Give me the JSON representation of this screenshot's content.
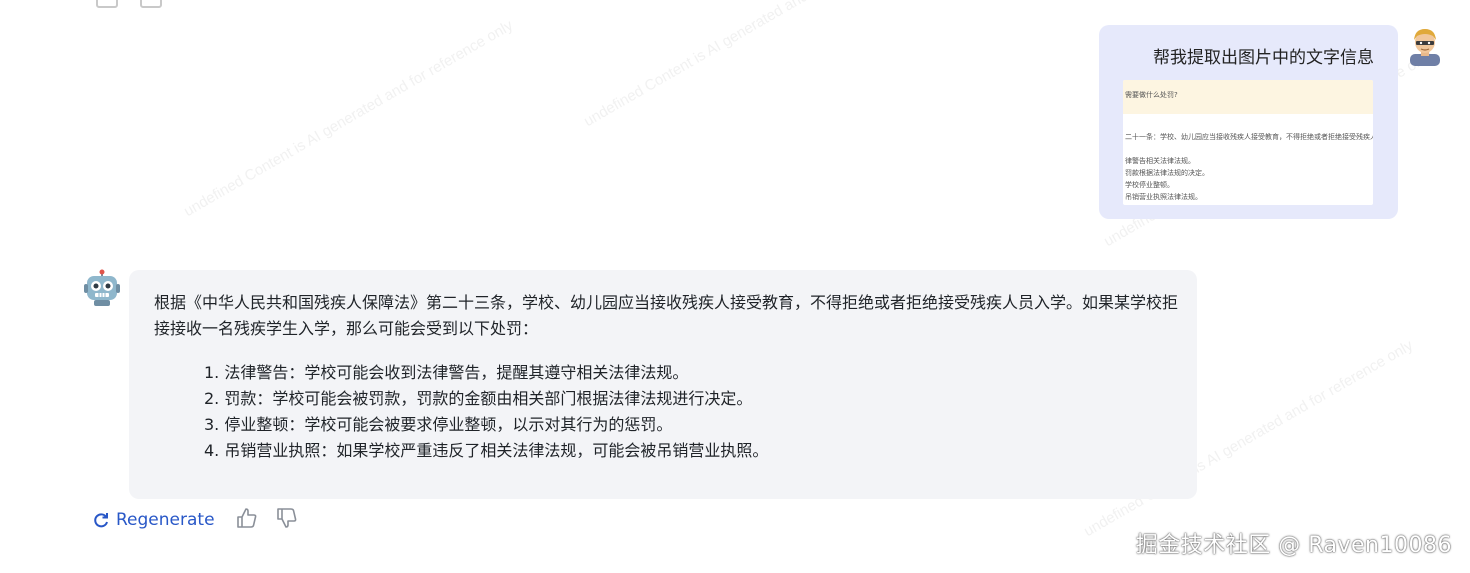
{
  "user_message": {
    "text": "帮我提取出图片中的文字信息",
    "thumbnail_lines": [
      "需要做什么处罚?",
      "二十一条：学校、幼儿园应当接收残疾人接受教育，不得拒绝或者拒绝接受残疾人",
      "律警告相关法律法规。",
      "罚款根据法律法规的决定。",
      "学校停业整顿。",
      "吊销营业执照法律法规。"
    ]
  },
  "bot_message": {
    "intro": "根据《中华人民共和国残疾人保障法》第二十三条，学校、幼儿园应当接收残疾人接受教育，不得拒绝或者拒绝接受残疾人员入学。如果某学校拒接接收一名残疾学生入学，那么可能会受到以下处罚：",
    "items": [
      "1. 法律警告：学校可能会收到法律警告，提醒其遵守相关法律法规。",
      "2. 罚款：学校可能会被罚款，罚款的金额由相关部门根据法律法规进行决定。",
      "3. 停业整顿：学校可能会被要求停业整顿，以示对其行为的惩罚。",
      "4. 吊销营业执照：如果学校严重违反了相关法律法规，可能会被吊销营业执照。"
    ]
  },
  "actions": {
    "regenerate_label": "Regenerate",
    "regenerate_icon": "refresh-icon",
    "thumbs_up_icon": "thumbs-up-icon",
    "thumbs_down_icon": "thumbs-down-icon"
  },
  "watermark_text": "undefined Content is AI generated and for reference only",
  "site_mark": "掘金技术社区 @ Raven10086",
  "colors": {
    "user_bubble": "#e6e9fb",
    "bot_bubble": "#f3f4f7",
    "accent": "#2857c7"
  }
}
